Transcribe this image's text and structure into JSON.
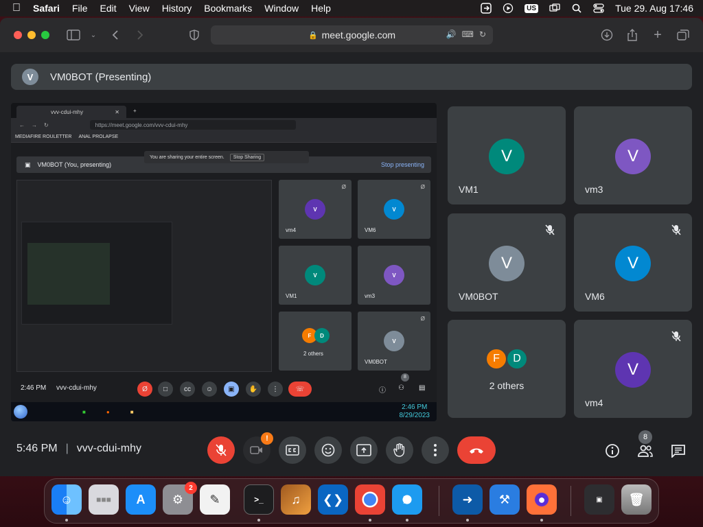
{
  "menubar": {
    "app": "Safari",
    "items": [
      "File",
      "Edit",
      "View",
      "History",
      "Bookmarks",
      "Window",
      "Help"
    ],
    "input_source": "US",
    "datetime": "Tue 29. Aug  17:46"
  },
  "browser": {
    "url": "meet.google.com"
  },
  "meet": {
    "presenting_initial": "V",
    "presenting_label": "VM0BOT (Presenting)",
    "time": "5:46 PM",
    "meeting_code": "vvv-cdui-mhy",
    "people_count": "8",
    "camera_alert": "!",
    "tiles": [
      {
        "initial": "V",
        "name": "VM1",
        "color": "#00897b",
        "muted": false
      },
      {
        "initial": "V",
        "name": "vm3",
        "color": "#7e57c2",
        "muted": false
      },
      {
        "initial": "V",
        "name": "VM0BOT",
        "color": "#7e8c99",
        "muted": true
      },
      {
        "initial": "V",
        "name": "VM6",
        "color": "#0288d1",
        "muted": true
      },
      {
        "initial": "V",
        "name": "vm4",
        "color": "#5e35b1",
        "muted": true
      }
    ],
    "others": {
      "a": "F",
      "b": "D",
      "label": "2 others",
      "color_a": "#f57c00",
      "color_b": "#00897b"
    }
  },
  "shared": {
    "tab_title": "vvv-cdui-mhy",
    "url": "https://meet.google.com/vvv-cdui-mhy",
    "bookmarks": [
      "MEDIAFIRE ROULETTER",
      "ANAL PROLAPSE"
    ],
    "share_notice": "You are sharing your entire screen.",
    "stop_sharing": "Stop Sharing",
    "presenting_label": "VM0BOT (You, presenting)",
    "stop_presenting": "Stop presenting",
    "time": "2:46 PM",
    "meeting_code": "vvv-cdui-mhy",
    "people_count": "8",
    "clock_time": "2:46 PM",
    "clock_date": "8/29/2023",
    "tiles": [
      {
        "initial": "V",
        "name": "vm4",
        "color": "#5e35b1"
      },
      {
        "initial": "V",
        "name": "VM6",
        "color": "#0288d1"
      },
      {
        "initial": "V",
        "name": "VM1",
        "color": "#00897b"
      },
      {
        "initial": "V",
        "name": "vm3",
        "color": "#7e57c2"
      },
      {
        "initial": "V",
        "name": "VM0BOT",
        "color": "#7e8c99"
      }
    ],
    "others": {
      "a": "F",
      "b": "D",
      "label": "2 others"
    }
  },
  "dock": {
    "settings_badge": "2",
    "apps": [
      "Finder",
      "Launchpad",
      "App Store",
      "System Settings",
      "TextEdit",
      "Terminal",
      "GarageBand",
      "Visual Studio Code",
      "Chrome",
      "Safari",
      "Remote",
      "Xcode",
      "Firefox",
      "Screenshot",
      "Trash"
    ]
  }
}
